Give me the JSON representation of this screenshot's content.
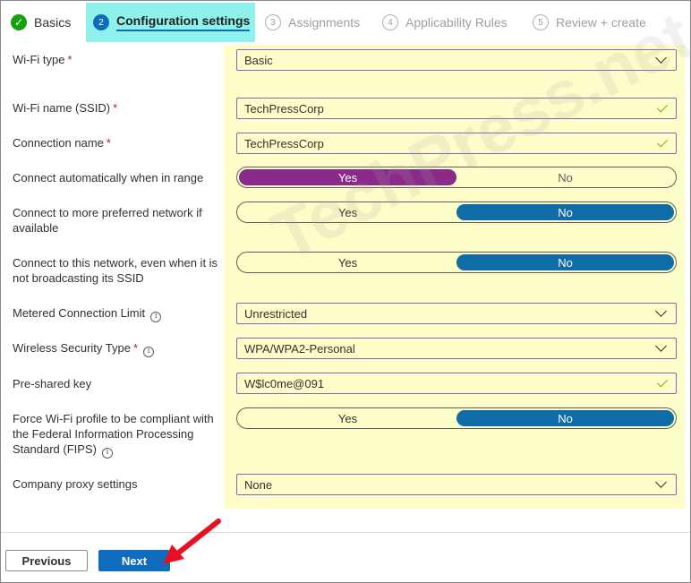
{
  "steps": [
    {
      "label": "Basics",
      "state": "done",
      "icon": "check-icon"
    },
    {
      "number": "2",
      "label": "Configuration settings",
      "state": "active"
    },
    {
      "number": "3",
      "label": "Assignments",
      "state": "todo"
    },
    {
      "number": "4",
      "label": "Applicability Rules",
      "state": "todo"
    },
    {
      "number": "5",
      "label": "Review + create",
      "state": "todo"
    }
  ],
  "form": {
    "wifi_type": {
      "label": "Wi-Fi type",
      "value": "Basic"
    },
    "wifi_name": {
      "label": "Wi-Fi name (SSID)",
      "value": "TechPressCorp"
    },
    "connection_name": {
      "label": "Connection name",
      "value": "TechPressCorp"
    },
    "connect_auto": {
      "label": "Connect automatically when in range",
      "yes": "Yes",
      "no": "No",
      "selected": "Yes"
    },
    "connect_preferred": {
      "label": "Connect to more preferred network if available",
      "yes": "Yes",
      "no": "No",
      "selected": "No"
    },
    "connect_hidden": {
      "label": "Connect to this network, even when it is not broadcasting its SSID",
      "yes": "Yes",
      "no": "No",
      "selected": "No"
    },
    "metered": {
      "label": "Metered Connection Limit",
      "value": "Unrestricted"
    },
    "security_type": {
      "label": "Wireless Security Type",
      "value": "WPA/WPA2-Personal"
    },
    "psk": {
      "label": "Pre-shared key",
      "value": "W$lc0me@091"
    },
    "fips": {
      "label": "Force Wi-Fi profile to be compliant with the Federal Information Processing Standard (FIPS)",
      "yes": "Yes",
      "no": "No",
      "selected": "No"
    },
    "proxy": {
      "label": "Company proxy settings",
      "value": "None"
    }
  },
  "required_mark": "*",
  "info_glyph": "i",
  "watermark": "TechPress.net",
  "footer": {
    "previous": "Previous",
    "next": "Next"
  },
  "colors": {
    "accent": "#0f6cbd",
    "toggle_purple": "#8a2a8a",
    "toggle_blue": "#0f6ca6",
    "highlight": "#fdfdc9",
    "active_step_bg": "#8ff1ec",
    "arrow": "#e81123"
  }
}
